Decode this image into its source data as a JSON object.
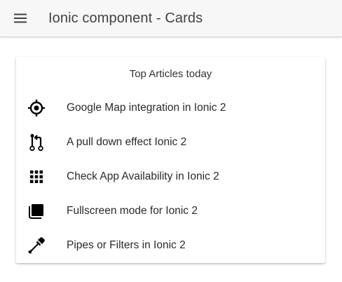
{
  "toolbar": {
    "menu_icon": "menu-icon",
    "title": "Ionic component - Cards"
  },
  "card": {
    "header": "Top Articles today",
    "items": [
      {
        "icon": "locate-icon",
        "label": "Google Map integration in Ionic 2"
      },
      {
        "icon": "git-pull-request-icon",
        "label": "A pull down effect Ionic 2"
      },
      {
        "icon": "apps-icon",
        "label": "Check App Availability in Ionic 2"
      },
      {
        "icon": "copy-icon",
        "label": "Fullscreen mode for Ionic 2"
      },
      {
        "icon": "eyedropper-icon",
        "label": "Pipes or Filters in Ionic 2"
      }
    ]
  },
  "colors": {
    "toolbar_bg": "#f7f7f7",
    "icon": "#000000",
    "text": "#2a2a2a"
  }
}
